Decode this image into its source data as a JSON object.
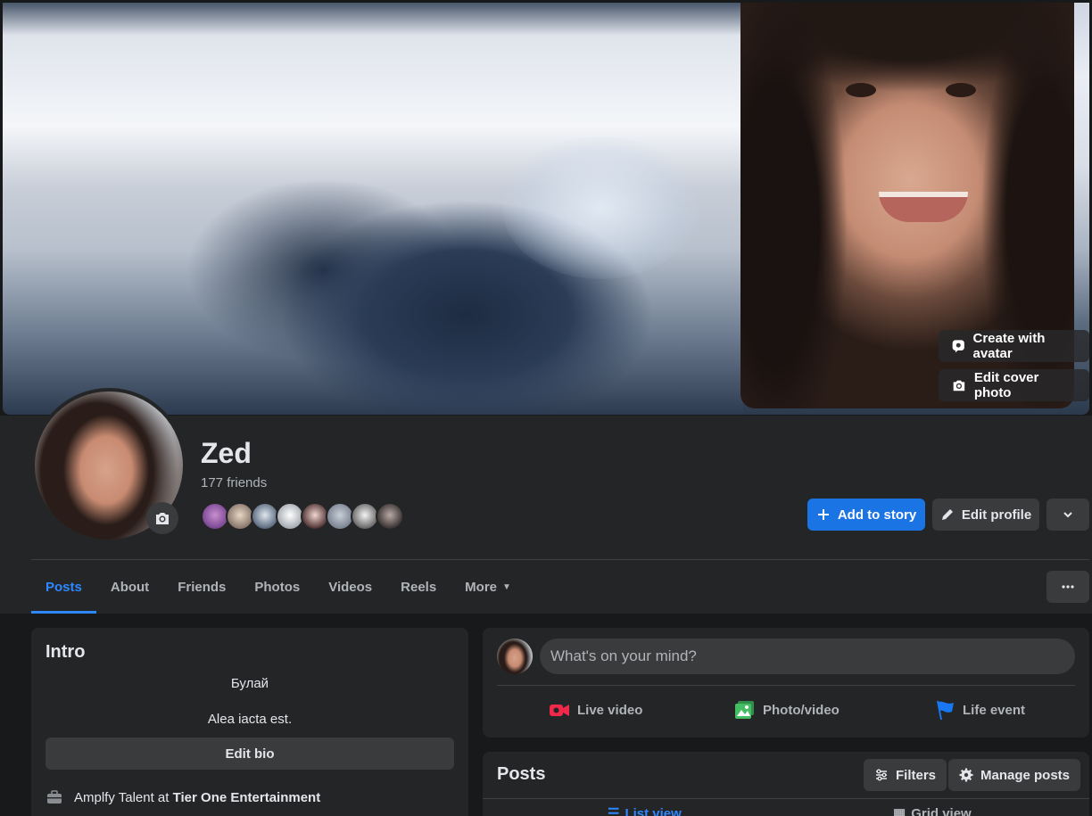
{
  "cover": {
    "create_avatar_label": "Create with avatar",
    "edit_cover_label": "Edit cover photo"
  },
  "profile": {
    "name": "Zed",
    "friends_count": "177 friends",
    "add_story_label": "Add to story",
    "edit_profile_label": "Edit profile"
  },
  "tabs": [
    {
      "label": "Posts",
      "active": true
    },
    {
      "label": "About"
    },
    {
      "label": "Friends"
    },
    {
      "label": "Photos"
    },
    {
      "label": "Videos"
    },
    {
      "label": "Reels"
    },
    {
      "label": "More"
    }
  ],
  "intro": {
    "title": "Intro",
    "line1": "Булай",
    "line2": "Alea iacta est.",
    "edit_bio_label": "Edit bio",
    "work_prefix": "Amplfy Talent at ",
    "work_company": "Tier One Entertainment"
  },
  "composer": {
    "placeholder": "What's on your mind?",
    "live_video": "Live video",
    "photo_video": "Photo/video",
    "life_event": "Life event"
  },
  "posts": {
    "title": "Posts",
    "filters_label": "Filters",
    "manage_label": "Manage posts",
    "list_view": "List view",
    "grid_view": "Grid view"
  },
  "colors": {
    "accent": "#2d88ff",
    "primary_button": "#1b74e4",
    "background": "#18191a",
    "card": "#242526",
    "live_red": "#f02849",
    "photo_green": "#45bd62",
    "flag_blue": "#1877f2"
  }
}
